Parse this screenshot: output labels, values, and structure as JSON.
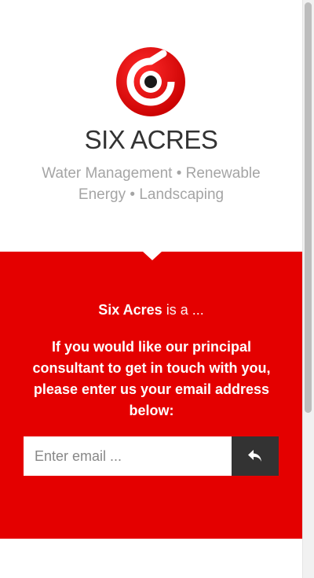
{
  "brand": {
    "name": "SIX ACRES",
    "tagline": "Water Management • Renewable Energy • Landscaping",
    "logo_colors": {
      "primary": "#e40000",
      "center": "#1a1a1a"
    }
  },
  "signup": {
    "intro_name": "Six Acres",
    "intro_suffix": " is a ...",
    "prompt": "If you would like our principal consultant to get in touch with you, please enter us your email address below:",
    "email_placeholder": "Enter email ...",
    "submit_icon": "reply-arrow-icon"
  },
  "colors": {
    "accent_red": "#e40000",
    "button_dark": "#333333",
    "tagline_gray": "#a5a5a5"
  }
}
